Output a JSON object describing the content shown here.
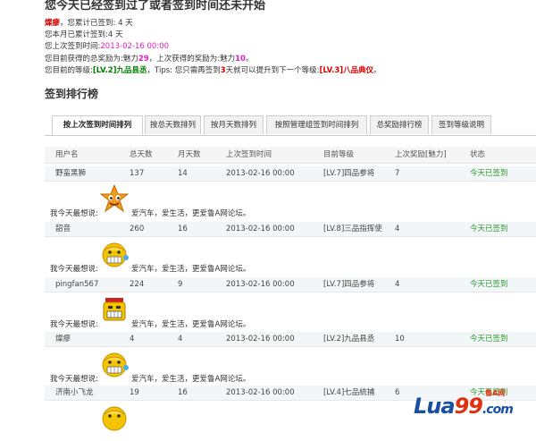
{
  "notice": "您今天已经签到过了或者签到时间还未开始",
  "info": {
    "username": "燦瘳",
    "line1_text": "，您累计已签到: 4 天",
    "line2": "您本月已累计签到:4 天",
    "line3_label": "您上次签到时间:",
    "line3_time": "2013-02-16 00:00",
    "line4_pre": "您目前获得的总奖励为:魅力",
    "line4_total": "29",
    "line4_mid": "，上次获得的奖励为:魅力",
    "line4_last": "10",
    "line4_end": "。",
    "line5_pre": "您目前的等级:",
    "line5_level": "[LV.2]九品县丞",
    "line5_mid": "，Tips: 您只需再签到",
    "line5_days": "3",
    "line5_mid2": "天就可以提升到下一个等级:",
    "line5_next": "[LV.3]八品典仪",
    "line5_end": "。"
  },
  "section_title": "签到排行榜",
  "tabs": [
    "按上次签到时间排列",
    "按总天数排列",
    "按月天数排列",
    "按照管理组签到时间排列",
    "总奖励排行榜",
    "签到等级说明"
  ],
  "table": {
    "headers": [
      "用户名",
      "总天数",
      "月天数",
      "上次签到时间",
      "目前等级",
      "上次奖励[魅力]",
      "状态"
    ],
    "rows": [
      {
        "name": "野蛮黑狮",
        "total": "137",
        "month": "14",
        "time": "2013-02-16 00:00",
        "level": "[LV.7]四品参将",
        "reward": "7",
        "status": "今天已签到",
        "mood_label": "我今天最想说:",
        "mood": "爱汽车，爱生活，更爱鲁A网论坛。"
      },
      {
        "name": "韶音",
        "total": "260",
        "month": "16",
        "time": "2013-02-16 00:00",
        "level": "[LV.8]三品指挥使",
        "reward": "4",
        "status": "今天已签到",
        "mood_label": "我今天最想说:",
        "mood": "爱汽车，爱生活，更爱鲁A网论坛。"
      },
      {
        "name": "pingfan567",
        "total": "224",
        "month": "9",
        "time": "2013-02-16 00:00",
        "level": "[LV.7]四品参将",
        "reward": "4",
        "status": "今天已签到",
        "mood_label": "我今天最想说:",
        "mood": "爱汽车，爱生活，更爱鲁A网论坛。"
      },
      {
        "name": "燦瘳",
        "total": "4",
        "month": "4",
        "time": "2013-02-16 00:00",
        "level": "[LV.2]九品县丞",
        "reward": "10",
        "status": "今天已签到",
        "mood_label": "我今天最想说:",
        "mood": "爱汽车，爱生活，更爱鲁A网论坛。"
      },
      {
        "name": "济南小飞龙",
        "total": "19",
        "month": "16",
        "time": "2013-02-16 00:00",
        "level": "[LV.4]七品統捕",
        "reward": "6",
        "status": "今天已签到",
        "mood_label": "",
        "mood": ""
      }
    ]
  },
  "logo": {
    "main": "Lua",
    "num": "99",
    "suffix": ".com",
    "sub": "鲁A网"
  },
  "colors": {
    "status_green": "#2a9a2a",
    "level_green": "#008000",
    "red": "#d00000",
    "magenta": "#e020c0",
    "row_bg": "#f3f6f9"
  }
}
